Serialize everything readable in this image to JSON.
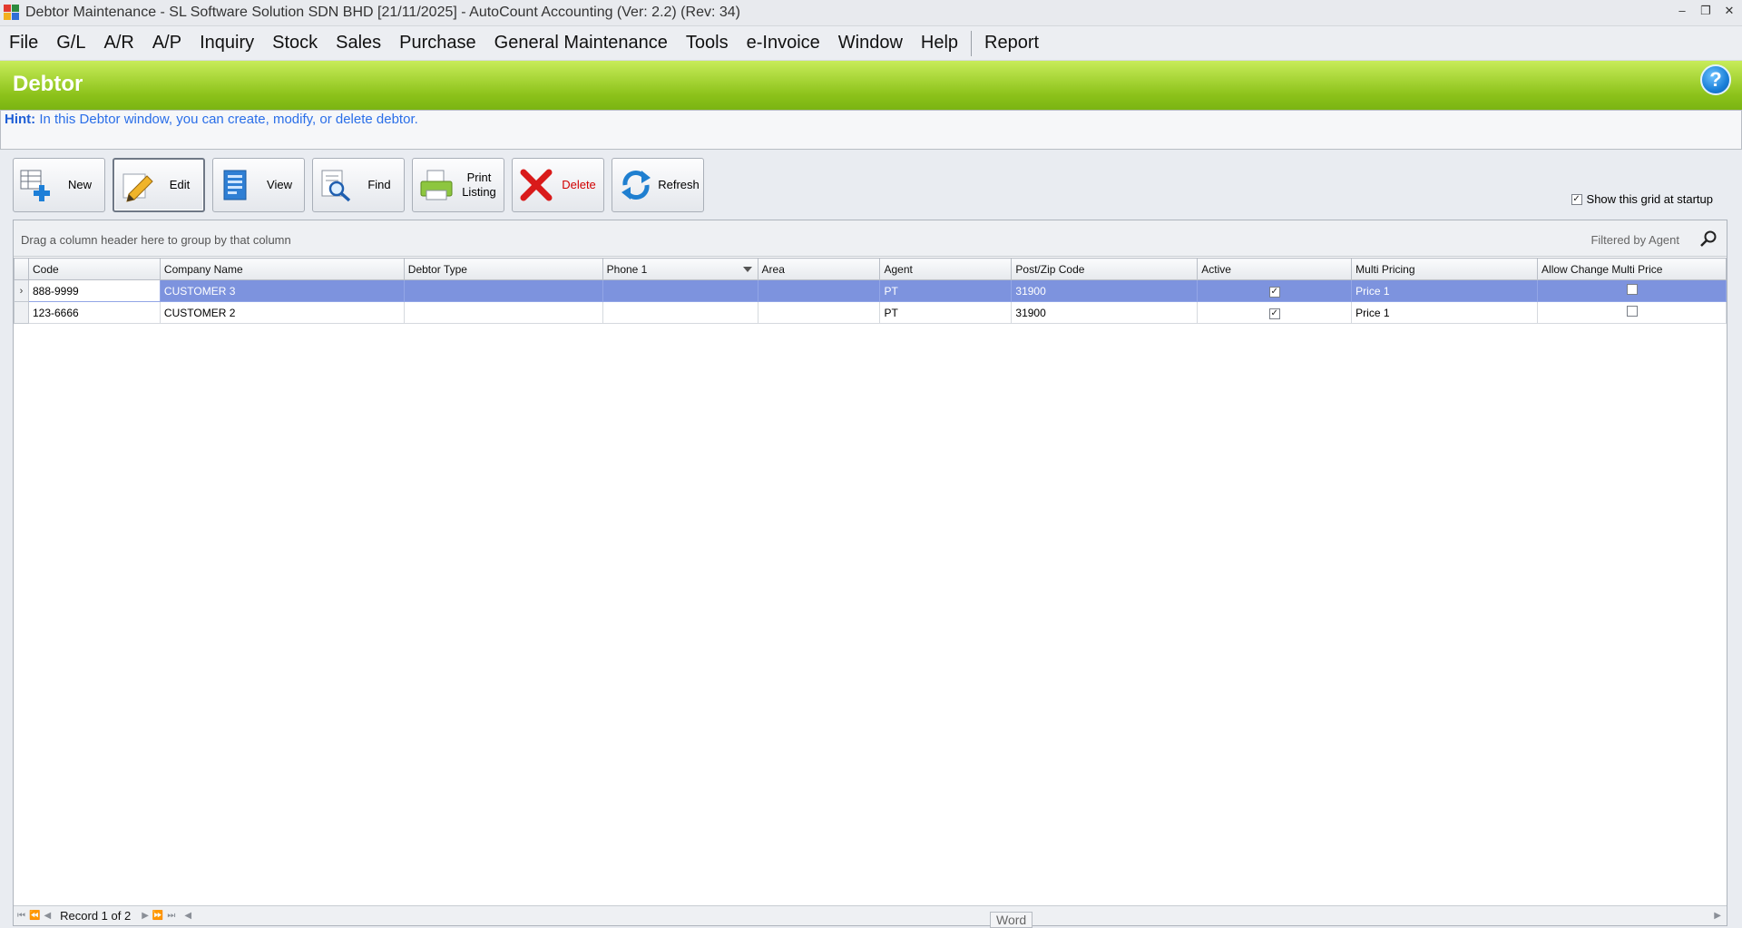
{
  "window": {
    "title": "Debtor Maintenance - SL Software Solution SDN BHD [21/11/2025] - AutoCount Accounting (Ver: 2.2) (Rev: 34)",
    "icon": "autocount-app-icon",
    "controls": [
      "minimize",
      "restore",
      "close"
    ]
  },
  "menu": {
    "items": [
      "File",
      "G/L",
      "A/R",
      "A/P",
      "Inquiry",
      "Stock",
      "Sales",
      "Purchase",
      "General Maintenance",
      "Tools",
      "e-Invoice",
      "Window",
      "Help"
    ],
    "report": "Report"
  },
  "header": {
    "title": "Debtor",
    "help_icon": "?"
  },
  "hint": {
    "label": "Hint:",
    "text": "In this Debtor window, you can create, modify, or delete debtor."
  },
  "toolbar": {
    "new": "New",
    "edit": "Edit",
    "view": "View",
    "find": "Find",
    "print_line1": "Print",
    "print_line2": "Listing",
    "delete": "Delete",
    "refresh": "Refresh"
  },
  "startup": {
    "label": "Show this grid at startup",
    "checked": true
  },
  "grid": {
    "group_hint": "Drag a column header here to group by that column",
    "filter_text": "Filtered by Agent",
    "columns": [
      "Code",
      "Company Name",
      "Debtor Type",
      "Phone 1",
      "Area",
      "Agent",
      "Post/Zip Code",
      "Active",
      "Multi Pricing",
      "Allow Change Multi Price"
    ],
    "rows": [
      {
        "code": "888-9999",
        "company": "CUSTOMER 3",
        "type": "",
        "phone": "",
        "area": "",
        "agent": "PT",
        "postcode": "31900",
        "active": true,
        "pricing": "Price 1",
        "allow_change": false,
        "selected": true
      },
      {
        "code": "123-6666",
        "company": "CUSTOMER 2",
        "type": "",
        "phone": "",
        "area": "",
        "agent": "PT",
        "postcode": "31900",
        "active": true,
        "pricing": "Price 1",
        "allow_change": false,
        "selected": false
      }
    ],
    "record_text": "Record 1 of 2"
  },
  "tooltip": "Word",
  "colors": {
    "header_green": "#8cc21a",
    "selection": "#7d93de",
    "hint_blue": "#2a6ee8",
    "delete_red": "#d10000"
  }
}
